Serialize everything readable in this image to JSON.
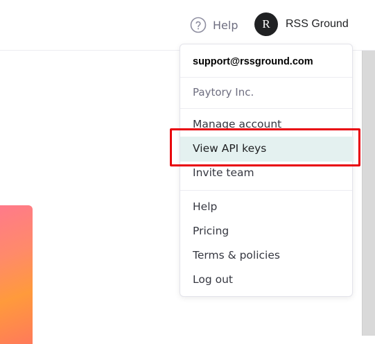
{
  "header": {
    "help_label": "Help",
    "help_icon": "question-circle-icon",
    "user_initial": "R",
    "user_name": "RSS Ground"
  },
  "account_menu": {
    "email": "support@rssground.com",
    "organization": "Paytory Inc.",
    "items": [
      {
        "label": "Manage account"
      },
      {
        "label": "View API keys",
        "highlighted": true
      },
      {
        "label": "Invite team"
      },
      {
        "label": "Help"
      },
      {
        "label": "Pricing"
      },
      {
        "label": "Terms & policies"
      },
      {
        "label": "Log out"
      }
    ]
  },
  "colors": {
    "highlight_bg": "#e4f1f0",
    "annotation_border": "#e8000a",
    "avatar_bg": "#202123"
  }
}
